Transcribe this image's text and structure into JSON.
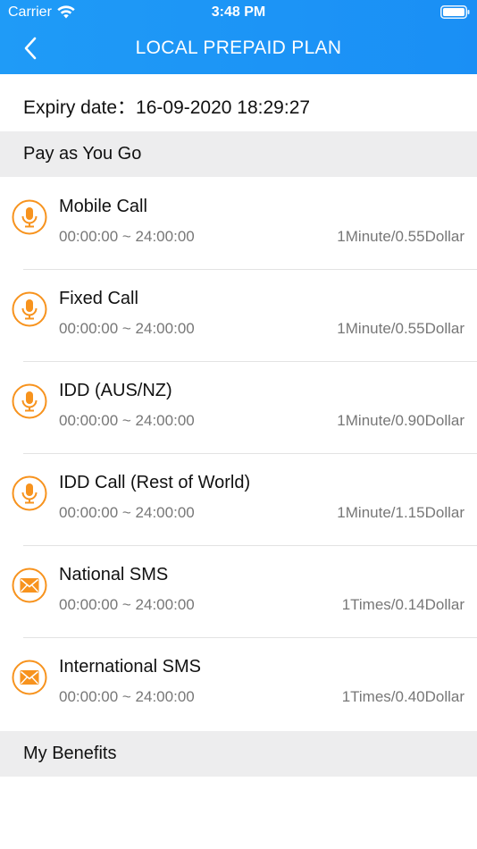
{
  "status_bar": {
    "carrier": "Carrier",
    "time": "3:48 PM"
  },
  "header": {
    "title": "LOCAL PREPAID PLAN"
  },
  "expiry": {
    "text": "Expiry date：16-09-2020 18:29:27"
  },
  "sections": {
    "pay_as_you_go": "Pay as You Go",
    "my_benefits": "My Benefits"
  },
  "items": [
    {
      "name": "Mobile Call",
      "time": "00:00:00 ~ 24:00:00",
      "rate": "1Minute/0.55Dollar",
      "icon": "microphone-icon"
    },
    {
      "name": "Fixed Call",
      "time": "00:00:00 ~ 24:00:00",
      "rate": "1Minute/0.55Dollar",
      "icon": "microphone-icon"
    },
    {
      "name": "IDD (AUS/NZ)",
      "time": "00:00:00 ~ 24:00:00",
      "rate": "1Minute/0.90Dollar",
      "icon": "microphone-icon"
    },
    {
      "name": "IDD Call (Rest of World)",
      "time": "00:00:00 ~ 24:00:00",
      "rate": "1Minute/1.15Dollar",
      "icon": "microphone-icon"
    },
    {
      "name": "National SMS",
      "time": "00:00:00 ~ 24:00:00",
      "rate": "1Times/0.14Dollar",
      "icon": "envelope-icon"
    },
    {
      "name": "International SMS",
      "time": "00:00:00 ~ 24:00:00",
      "rate": "1Times/0.40Dollar",
      "icon": "envelope-icon"
    }
  ],
  "colors": {
    "header_blue": "#1a8ff5",
    "icon_orange": "#f7931e",
    "section_grey": "#ededee"
  }
}
